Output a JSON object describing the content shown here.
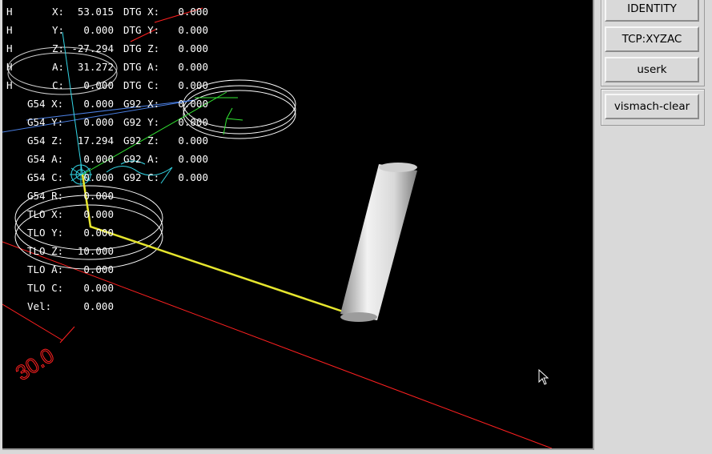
{
  "dro": {
    "rows": [
      {
        "homed": "H",
        "label": "X:",
        "value": "53.015",
        "label2": "DTG X:",
        "value2": "0.000"
      },
      {
        "homed": "H",
        "label": "Y:",
        "value": "0.000",
        "label2": "DTG Y:",
        "value2": "0.000"
      },
      {
        "homed": "H",
        "label": "Z:",
        "value": "-27.294",
        "label2": "DTG Z:",
        "value2": "0.000"
      },
      {
        "homed": "H",
        "label": "A:",
        "value": "31.272",
        "label2": "DTG A:",
        "value2": "0.000"
      },
      {
        "homed": "H",
        "label": "C:",
        "value": "0.000",
        "label2": "DTG C:",
        "value2": "0.000"
      },
      {
        "homed": "",
        "label": "G54 X:",
        "value": "0.000",
        "label2": "G92 X:",
        "value2": "0.000"
      },
      {
        "homed": "",
        "label": "G54 Y:",
        "value": "0.000",
        "label2": "G92 Y:",
        "value2": "0.000"
      },
      {
        "homed": "",
        "label": "G54 Z:",
        "value": "17.294",
        "label2": "G92 Z:",
        "value2": "0.000"
      },
      {
        "homed": "",
        "label": "G54 A:",
        "value": "0.000",
        "label2": "G92 A:",
        "value2": "0.000"
      },
      {
        "homed": "",
        "label": "G54 C:",
        "value": "0.000",
        "label2": "G92 C:",
        "value2": "0.000"
      },
      {
        "homed": "",
        "label": "G54 R:",
        "value": "0.000",
        "label2": "",
        "value2": ""
      },
      {
        "homed": "",
        "label": "TLO X:",
        "value": "0.000",
        "label2": "",
        "value2": ""
      },
      {
        "homed": "",
        "label": "TLO Y:",
        "value": "0.000",
        "label2": "",
        "value2": ""
      },
      {
        "homed": "",
        "label": "TLO Z:",
        "value": "10.000",
        "label2": "",
        "value2": ""
      },
      {
        "homed": "",
        "label": "TLO A:",
        "value": "0.000",
        "label2": "",
        "value2": ""
      },
      {
        "homed": "",
        "label": "TLO C:",
        "value": "0.000",
        "label2": "",
        "value2": ""
      },
      {
        "homed": "",
        "label": "Vel:",
        "value": "0.000",
        "label2": "",
        "value2": ""
      }
    ]
  },
  "scene": {
    "dimension_label": "30.0",
    "colors": {
      "background": "#000000",
      "dro_text": "#ffffff",
      "toolpath": "#e6e62e",
      "limits": "#ff2020",
      "fixture": "#ffffff",
      "origin": "#33d6e6",
      "axis_green": "#33e633"
    }
  },
  "side_panel": {
    "group1": [
      "IDENTITY",
      "TCP:XYZAC",
      "userk"
    ],
    "group2": [
      "vismach-clear"
    ]
  },
  "cursor": {
    "icon": "mouse-pointer-icon"
  }
}
